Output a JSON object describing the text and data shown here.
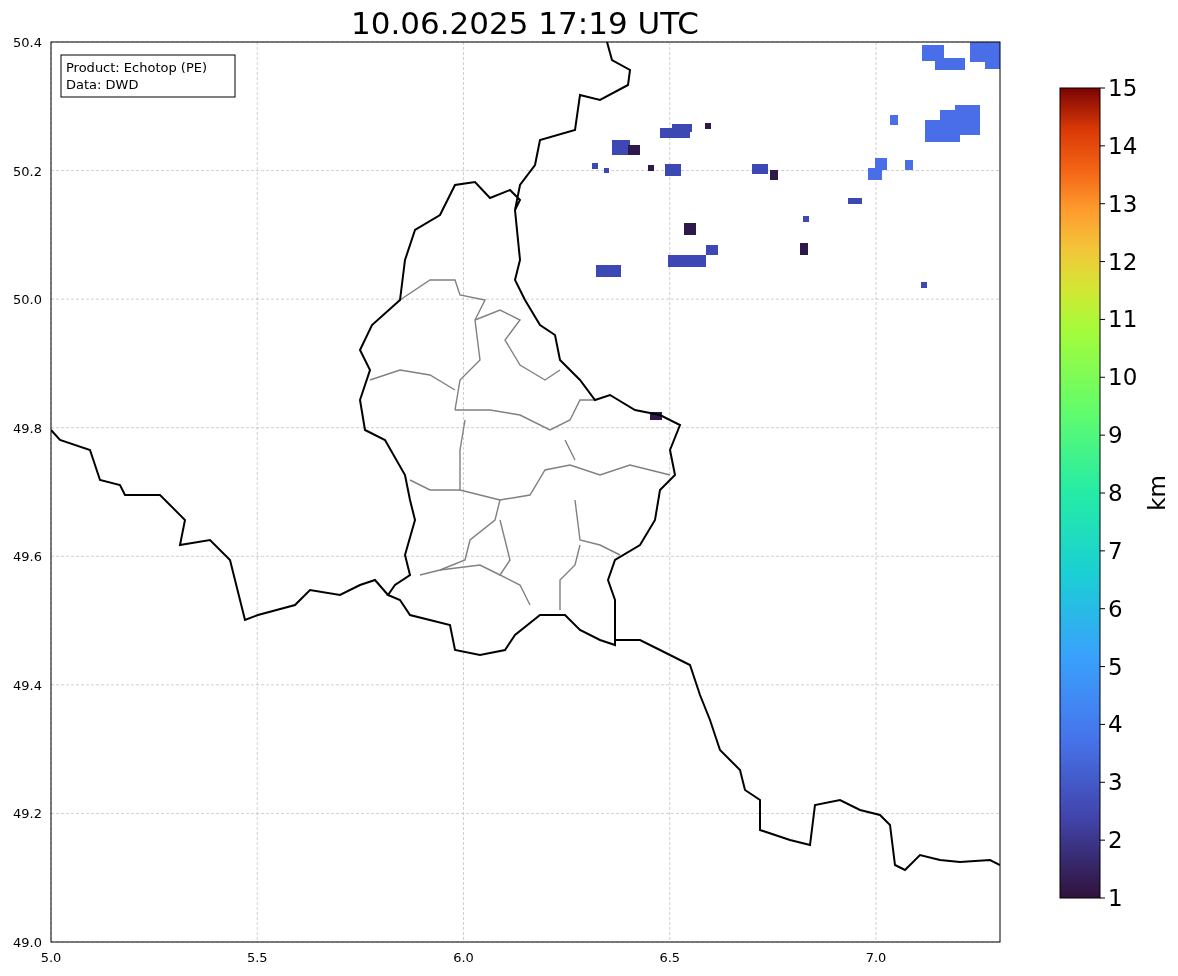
{
  "title": "10.06.2025 17:19 UTC",
  "info_box": {
    "lines": [
      "Product: Echotop (PE)",
      "Data: DWD"
    ]
  },
  "map": {
    "xticks": [
      "5.0",
      "5.5",
      "6.0",
      "6.5",
      "7.0"
    ],
    "yticks": [
      "50.4",
      "50.2",
      "50.0",
      "49.8",
      "49.6",
      "49.4",
      "49.2",
      "49.0"
    ]
  },
  "colorbar": {
    "ticks": [
      "15",
      "14",
      "13",
      "12",
      "11",
      "10",
      "9",
      "8",
      "7",
      "6",
      "5",
      "4",
      "3",
      "2",
      "1"
    ],
    "label": "km"
  }
}
